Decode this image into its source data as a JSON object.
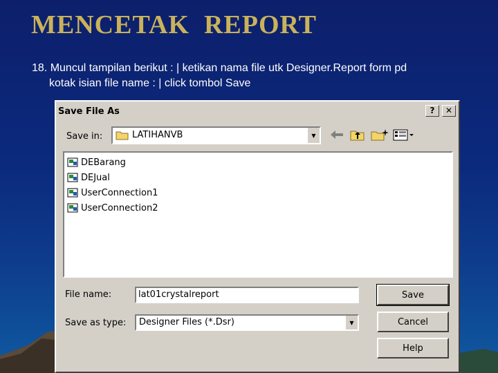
{
  "slide": {
    "title": "MENCETAK  REPORT",
    "instruction_line1": "18. Muncul tampilan berikut : |  ketikan nama file utk Designer.Report form  pd",
    "instruction_line2": "kotak isian file name : |  click tombol Save"
  },
  "dialog": {
    "title": "Save File As",
    "help_glyph": "?",
    "close_glyph": "✕",
    "save_in_label": "Save in:",
    "save_in_value": "LATIHANVB",
    "files": [
      "DEBarang",
      "DEJual",
      "UserConnection1",
      "UserConnection2"
    ],
    "file_name_label": "File name:",
    "file_name_value": "lat01crystalreport",
    "save_as_type_label": "Save as type:",
    "save_as_type_value": "Designer Files (*.Dsr)",
    "buttons": {
      "save": "Save",
      "cancel": "Cancel",
      "help": "Help"
    }
  },
  "colors": {
    "title": "#c9b25a",
    "background": "#0d1f6b",
    "dialog": "#d4d0c8"
  },
  "icons": [
    "folder-icon",
    "back-arrow-icon",
    "up-folder-icon",
    "new-folder-icon",
    "view-menu-icon",
    "designer-file-icon"
  ]
}
